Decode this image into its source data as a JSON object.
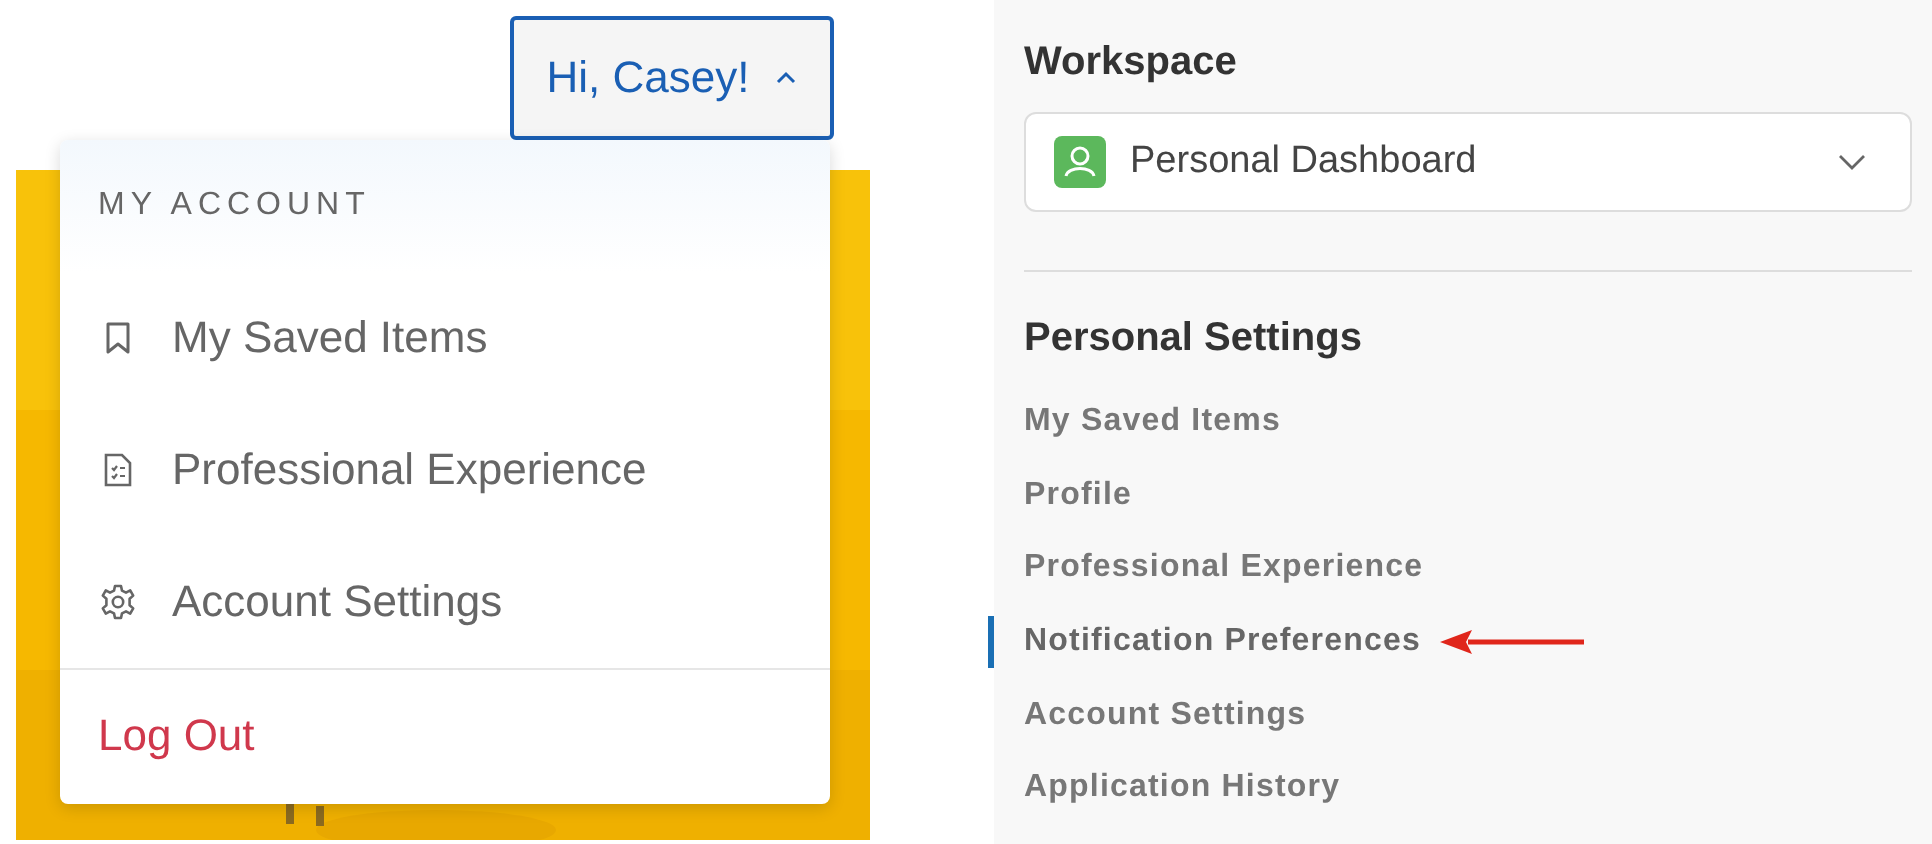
{
  "account_button": {
    "label": "Hi, Casey!",
    "expanded": true
  },
  "account_menu": {
    "heading": "MY ACCOUNT",
    "items": [
      {
        "label": "My Saved Items",
        "kind": "bookmark"
      },
      {
        "label": "Professional Experience",
        "kind": "document"
      },
      {
        "label": "Account Settings",
        "kind": "gear"
      },
      {
        "label": "Log Out",
        "kind": "logout"
      }
    ]
  },
  "workspace": {
    "heading": "Workspace",
    "value": "Personal Dashboard"
  },
  "personal_settings": {
    "heading": "Personal Settings",
    "items": [
      {
        "label": "My Saved Items",
        "selected": false
      },
      {
        "label": "Profile",
        "selected": false
      },
      {
        "label": "Professional Experience",
        "selected": false
      },
      {
        "label": "Notification Preferences",
        "selected": true
      },
      {
        "label": "Account Settings",
        "selected": false
      },
      {
        "label": "Application History",
        "selected": false
      }
    ]
  }
}
